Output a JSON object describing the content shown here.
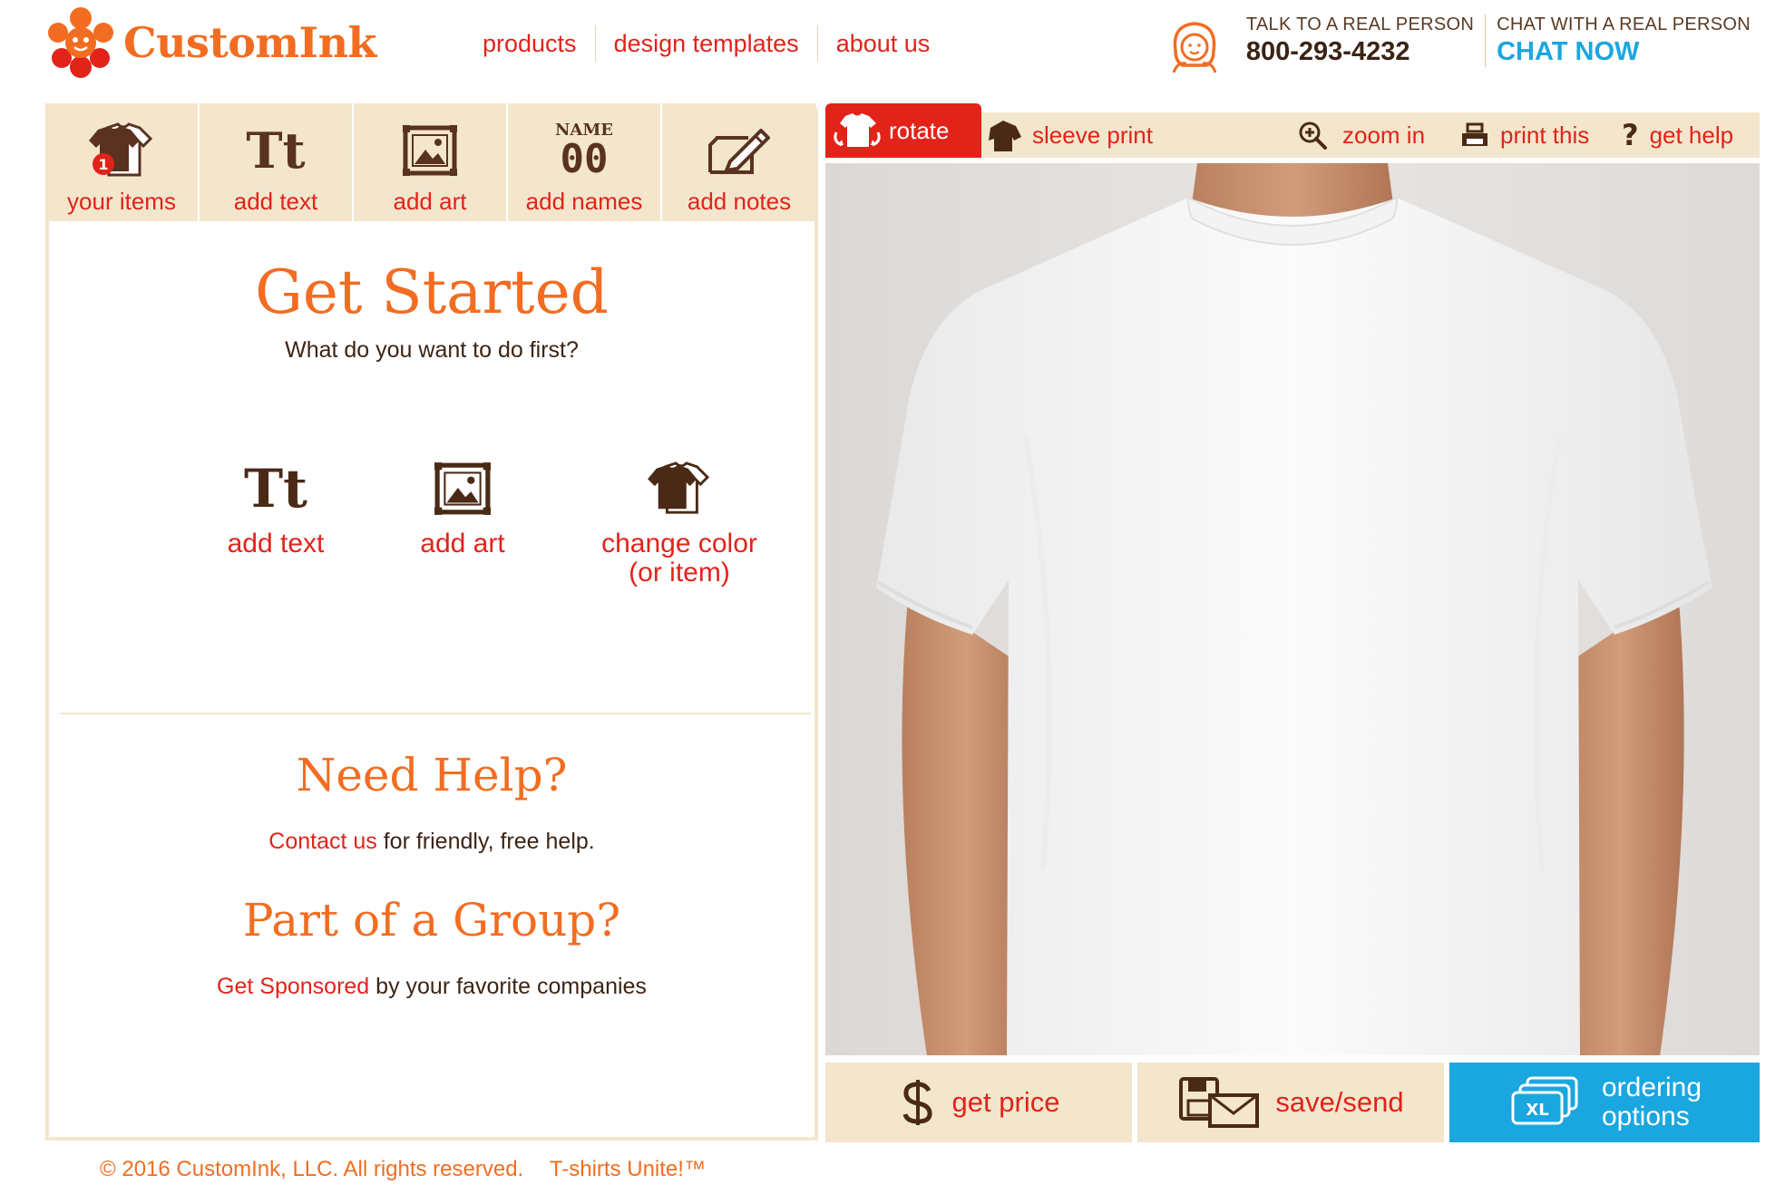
{
  "header": {
    "logo_text": "CustomInk",
    "nav": [
      "products",
      "design templates",
      "about us"
    ],
    "support": {
      "talk_label": "TALK TO A REAL PERSON",
      "phone": "800-293-4232",
      "chat_label": "CHAT WITH A REAL PERSON",
      "chat_cta": "CHAT NOW"
    }
  },
  "tool_tabs": [
    {
      "label": "your items",
      "icon": "shirt-stack-icon",
      "badge": "1"
    },
    {
      "label": "add text",
      "icon": "text-tt-icon",
      "glyph": "Tt"
    },
    {
      "label": "add art",
      "icon": "picture-frame-icon"
    },
    {
      "label": "add names",
      "icon": "name-number-icon",
      "name_word": "NAME",
      "number": "00"
    },
    {
      "label": "add notes",
      "icon": "notepad-pencil-icon"
    }
  ],
  "get_started": {
    "title": "Get Started",
    "subtitle": "What do you want to do first?",
    "options": [
      {
        "label": "add text",
        "glyph": "Tt"
      },
      {
        "label": "add art"
      },
      {
        "label_line1": "change color",
        "label_line2": "(or item)"
      }
    ]
  },
  "help": {
    "title": "Need Help?",
    "link": "Contact us",
    "text": "for friendly, free help."
  },
  "group": {
    "title": "Part of a Group?",
    "link": "Get Sponsored",
    "text": "by your favorite companies"
  },
  "footer": {
    "copyright": "© 2016 CustomInk, LLC. All rights reserved.",
    "tagline": "T-shirts Unite!™"
  },
  "toolbar": {
    "rotate": "rotate",
    "sleeve_print": "sleeve print",
    "zoom_in": "zoom in",
    "print_this": "print this",
    "get_help": "get help"
  },
  "actions": {
    "get_price": "get price",
    "save_send": "save/send",
    "ordering_line1": "ordering",
    "ordering_line2": "options",
    "xl_badge": "XL"
  },
  "colors": {
    "brand_orange": "#f26d21",
    "link_red": "#e2231a",
    "tan": "#f3e6cc",
    "brown": "#4a2a16",
    "chat_blue": "#1aa7e0"
  }
}
